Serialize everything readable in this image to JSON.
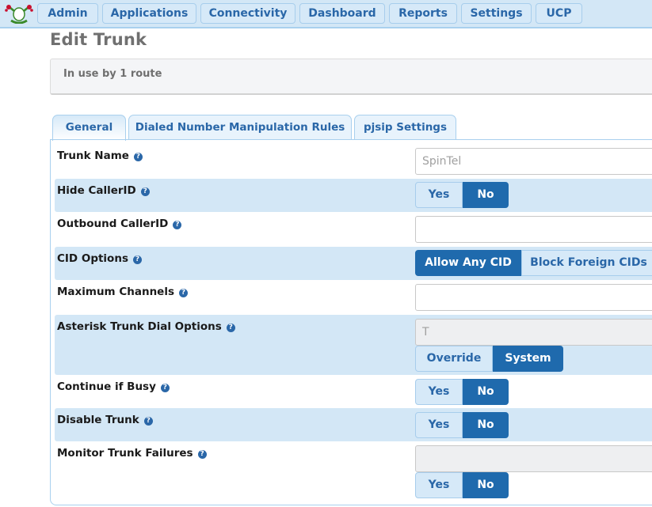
{
  "nav": {
    "logo": "frog-logo-icon",
    "items": [
      {
        "label": "Admin"
      },
      {
        "label": "Applications"
      },
      {
        "label": "Connectivity"
      },
      {
        "label": "Dashboard"
      },
      {
        "label": "Reports"
      },
      {
        "label": "Settings"
      },
      {
        "label": "UCP"
      }
    ]
  },
  "page": {
    "title": "Edit Trunk",
    "info": "In use by 1 route"
  },
  "tabs": [
    {
      "label": "General",
      "active": true
    },
    {
      "label": "Dialed Number Manipulation Rules",
      "active": false
    },
    {
      "label": "pjsip Settings",
      "active": false
    }
  ],
  "help_glyph": "?",
  "form": {
    "trunk_name": {
      "label": "Trunk Name",
      "value": "SpinTel"
    },
    "hide_callerid": {
      "label": "Hide CallerID",
      "options": [
        "Yes",
        "No"
      ],
      "selected": "No"
    },
    "outbound_callerid": {
      "label": "Outbound CallerID",
      "value": ""
    },
    "cid_options": {
      "label": "CID Options",
      "options": [
        "Allow Any CID",
        "Block Foreign CIDs"
      ],
      "selected": "Allow Any CID"
    },
    "max_channels": {
      "label": "Maximum Channels",
      "value": ""
    },
    "dial_options": {
      "label": "Asterisk Trunk Dial Options",
      "value": "T",
      "options": [
        "Override",
        "System"
      ],
      "selected": "System"
    },
    "continue_if_busy": {
      "label": "Continue if Busy",
      "options": [
        "Yes",
        "No"
      ],
      "selected": "No"
    },
    "disable_trunk": {
      "label": "Disable Trunk",
      "options": [
        "Yes",
        "No"
      ],
      "selected": "No"
    },
    "monitor_failures": {
      "label": "Monitor Trunk Failures",
      "value": "",
      "options": [
        "Yes",
        "No"
      ],
      "selected": "No"
    }
  }
}
